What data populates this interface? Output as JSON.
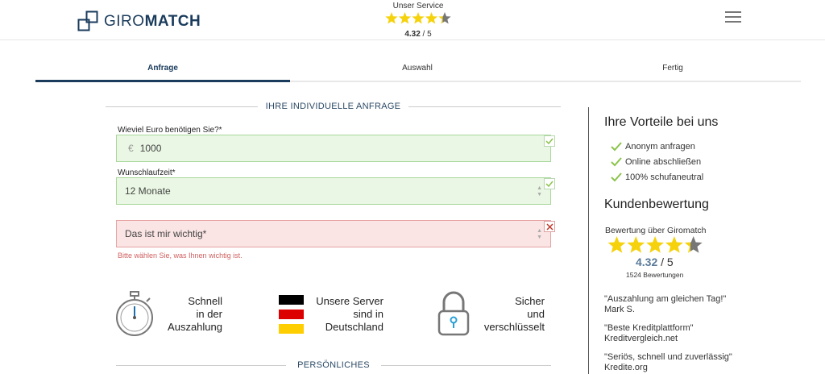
{
  "header": {
    "logo_text_light": "GIRO",
    "logo_text_bold": "MATCH",
    "service_label": "Unser Service",
    "rating_value": "4.32",
    "rating_suffix": " / 5",
    "rating_fraction": 0.864
  },
  "steps": [
    {
      "label": "Anfrage",
      "active": true
    },
    {
      "label": "Auswahl",
      "active": false
    },
    {
      "label": "Fertig",
      "active": false
    }
  ],
  "form": {
    "section_title": "IHRE INDIVIDUELLE ANFRAGE",
    "amount_label": "Wieviel Euro benötigen Sie?*",
    "currency_symbol": "€",
    "amount_value": "1000",
    "term_label": "Wunschlaufzeit*",
    "term_value": "12 Monate",
    "importance_placeholder": "Das ist mir wichtig*",
    "importance_error": "Bitte wählen Sie, was Ihnen wichtig ist."
  },
  "features": {
    "fast": [
      "Schnell",
      "in der",
      "Auszahlung"
    ],
    "servers": [
      "Unsere Server",
      "sind in",
      "Deutschland"
    ],
    "secure": [
      "Sicher",
      "und",
      "verschlüsselt"
    ]
  },
  "personal_section_title": "PERSÖNLICHES",
  "sidebar": {
    "advantages_title": "Ihre Vorteile bei uns",
    "advantages": [
      "Anonym anfragen",
      "Online abschließen",
      "100% schufaneutral"
    ],
    "reviews_title": "Kundenbewertung",
    "rating_source": "Bewertung über Giromatch",
    "rating_value": "4.32",
    "rating_suffix": " / 5",
    "review_count": "1524 Bewertungen",
    "quotes": [
      {
        "text": "\"Auszahlung am gleichen Tag!\"",
        "author": "Mark S."
      },
      {
        "text": "\"Beste Kreditplattform\"",
        "author": "Kreditvergleich.net"
      },
      {
        "text": "\"Seriös, schnell und zuverlässig\"",
        "author": "Kredite.org"
      }
    ]
  },
  "colors": {
    "brand": "#1a3b5c",
    "star_fill": "#f5d20c",
    "star_empty": "#777777",
    "valid_bg": "#eaf7e4",
    "error_bg": "#fbe4e4",
    "check_green": "#8bc34a"
  }
}
